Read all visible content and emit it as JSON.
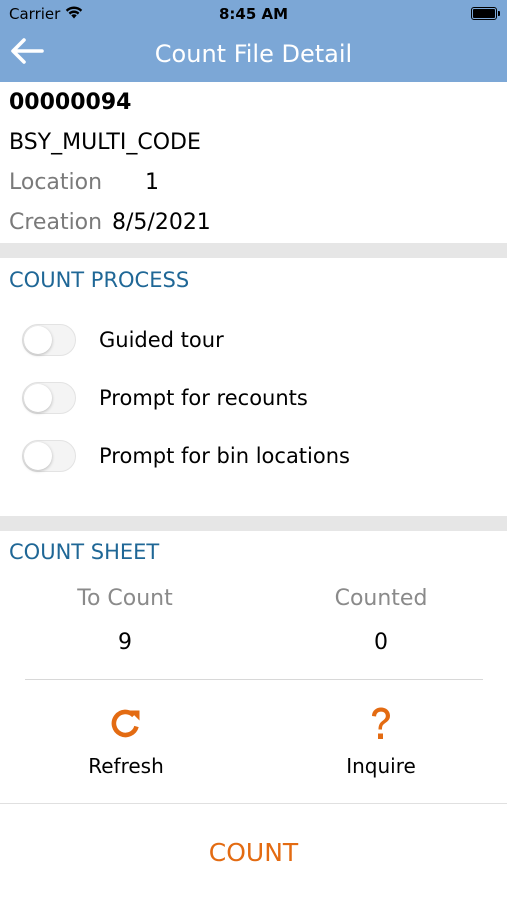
{
  "status_bar": {
    "carrier": "Carrier",
    "time": "8:45 AM"
  },
  "nav": {
    "title": "Count File Detail",
    "back_icon": "arrow-left-icon"
  },
  "file": {
    "number": "00000094",
    "code": "BSY_MULTI_CODE",
    "location_label": "Location",
    "location_value": "1",
    "creation_label": "Creation",
    "creation_value": "8/5/2021"
  },
  "count_process": {
    "title": "COUNT PROCESS",
    "options": [
      {
        "label": "Guided tour",
        "enabled": false
      },
      {
        "label": "Prompt for recounts",
        "enabled": false
      },
      {
        "label": "Prompt for bin locations",
        "enabled": false
      }
    ]
  },
  "count_sheet": {
    "title": "COUNT SHEET",
    "to_count_label": "To Count",
    "to_count_value": "9",
    "counted_label": "Counted",
    "counted_value": "0"
  },
  "actions": {
    "refresh_label": "Refresh",
    "refresh_icon": "refresh-icon",
    "inquire_label": "Inquire",
    "inquire_icon": "question-icon"
  },
  "count_button": "COUNT",
  "colors": {
    "nav_bg": "#7ca7d6",
    "section_title": "#1f6796",
    "accent": "#e36b12"
  }
}
